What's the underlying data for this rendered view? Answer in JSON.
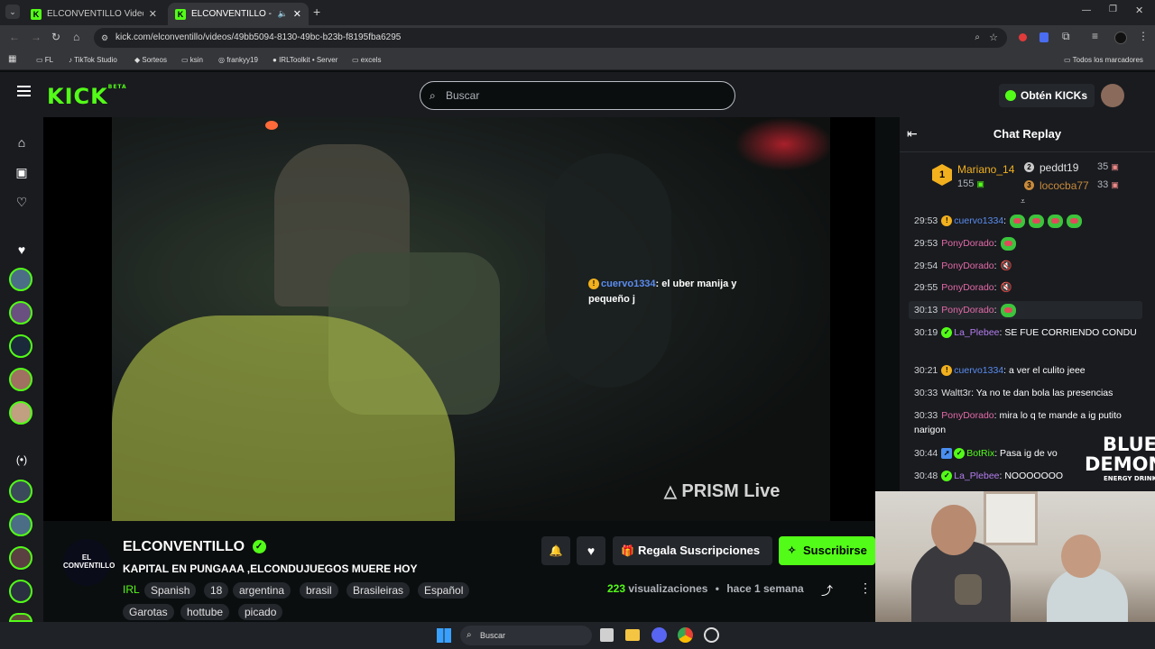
{
  "browser": {
    "tabs": [
      {
        "title": "ELCONVENTILLO Videos - Watch"
      },
      {
        "title": "ELCONVENTILLO - Watch E"
      }
    ],
    "url": "kick.com/elconventillo/videos/49bb5094-8130-49bc-b23b-f8195fba6295",
    "bookmarks": [
      "FL",
      "TikTok Studio",
      "Sorteos",
      "ksin",
      "frankyy19",
      "IRLToolkit • Server",
      "excels"
    ],
    "bookmarks_right": "Todos los marcadores"
  },
  "header": {
    "logo": "KICK",
    "logo_beta": "BETA",
    "search_placeholder": "Buscar",
    "get_kicks": "Obtén KICKs"
  },
  "video": {
    "overlay_user": "cuervo1334",
    "overlay_text": ": el uber manija y pequeño j",
    "watermark": "PRISM Live"
  },
  "channel": {
    "avatar_text": "EL CONVENTILLO",
    "name": "ELCONVENTILLO",
    "title": "KAPITAL EN PUNGAAA ,ELCONDUJUEGOS MUERE HOY",
    "category": "IRL",
    "tags_row1": [
      "Spanish",
      "18",
      "argentina",
      "brasil",
      "Brasileiras",
      "Español"
    ],
    "tags_row2": [
      "Garotas",
      "hottube",
      "picado"
    ],
    "gift_label": "Regala Suscripciones",
    "subscribe_label": "Suscribirse",
    "views_count": "223",
    "views_label": "visualizaciones",
    "date": "hace 1 semana"
  },
  "chat": {
    "title": "Chat Replay",
    "leaderboard": {
      "first": {
        "rank": "1",
        "name": "Mariano_14",
        "value": "155"
      },
      "second": {
        "rank": "2",
        "name": "peddt19",
        "value": "35"
      },
      "third": {
        "rank": "3",
        "name": "lococba77",
        "value": "33"
      }
    },
    "messages": [
      {
        "time": "29:53",
        "user": "cuervo1334",
        "text": ":"
      },
      {
        "time": "29:53",
        "user": "PonyDorado",
        "text": ":"
      },
      {
        "time": "29:54",
        "user": "PonyDorado",
        "text": ":"
      },
      {
        "time": "29:55",
        "user": "PonyDorado",
        "text": ":"
      },
      {
        "time": "30:13",
        "user": "PonyDorado",
        "text": ":"
      },
      {
        "time": "30:19",
        "user": "La_Plebee",
        "text": ": SE FUE CORRIENDO CONDU"
      },
      {
        "time": "30:21",
        "user": "cuervo1334",
        "text": ": a ver el culito jeee"
      },
      {
        "time": "30:33",
        "user": "Waltt3r",
        "text": ": Ya no te dan bola las presencias"
      },
      {
        "time": "30:33",
        "user": "PonyDorado",
        "text": ": mira lo q te mande a ig putito narigon"
      },
      {
        "time": "30:44",
        "user": "BotRix",
        "text": ": Pasa ig de vo"
      },
      {
        "time": "30:48",
        "user": "La_Plebee",
        "text": ": NOOOOOOO"
      }
    ]
  },
  "overlay_brand": {
    "line1": "BLUE",
    "line2": "DEMON",
    "line3": "ENERGY DRINK"
  },
  "taskbar": {
    "search": "Buscar"
  },
  "colors": {
    "kick_green": "#53fc18",
    "bg": "#0b0e0f",
    "panel": "#191b1f"
  }
}
